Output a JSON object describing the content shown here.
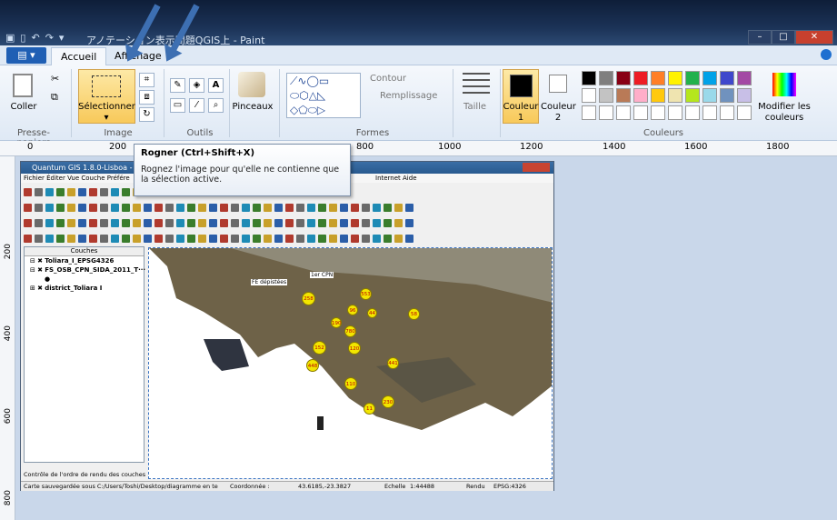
{
  "window": {
    "title": "アノテーション表示問題QGIS上 - Paint",
    "controls": [
      "–",
      "□",
      "✕"
    ]
  },
  "ribbon": {
    "file_menu": "▤ ▾",
    "tabs": [
      "Accueil",
      "Affichage"
    ],
    "coller": "Coller",
    "selectionner": "Sélectionner",
    "pinceaux": "Pinceaux",
    "contour": "Contour",
    "remplissage": "Remplissage",
    "taille": "Taille",
    "couleur1": "Couleur",
    "couleur1_num": "1",
    "couleur2": "Couleur",
    "couleur2_num": "2",
    "modifier": "Modifier les",
    "modifier2": "couleurs",
    "groups": {
      "presse": "Presse-papiers",
      "image": "Image",
      "outils": "Outils",
      "formes": "Formes",
      "couleurs": "Couleurs"
    },
    "palette": [
      "#000000",
      "#7f7f7f",
      "#880015",
      "#ed1c24",
      "#ff7f27",
      "#fff200",
      "#22b14c",
      "#00a2e8",
      "#3f48cc",
      "#a349a4",
      "#ffffff",
      "#c3c3c3",
      "#b97a57",
      "#ffaec9",
      "#ffc90e",
      "#efe4b0",
      "#b5e61d",
      "#99d9ea",
      "#7092be",
      "#c8bfe7"
    ]
  },
  "ruler": {
    "h": [
      "0",
      "200",
      "400",
      "800",
      "1000",
      "1200",
      "1400",
      "1600",
      "1800"
    ],
    "v": [
      "200",
      "400",
      "600",
      "800"
    ]
  },
  "tooltip": {
    "title": "Rogner (Ctrl+Shift+X)",
    "text": "Rognez l'image pour qu'elle ne contienne que la sélection active."
  },
  "qgis": {
    "title": "Quantum GIS 1.8.0-Lisboa - sess",
    "menu": "Fichier  Éditer  Vue  Couche  Préfére",
    "menu_right": "Internet  Aide",
    "layers_header": "Couches",
    "layers": [
      "Toliara_I_EPSG4326",
      "FS_OSB_CPN_SIDA_2011_T···",
      "district_Toliara I"
    ],
    "render_order": "Contrôle de l'ordre de rendu des couches",
    "status": "Carte sauvegardée sous C:/Users/Toshi/Desktop/diagramme en te",
    "coord_label": "Coordonnée :",
    "coord": "43.6185,-23.3827",
    "scale_label": "Echelle",
    "scale": "1:44488",
    "render": "Rendu",
    "epsg": "EPSG:4326",
    "map_labels": [
      "FE dépistées",
      "1er CPN"
    ],
    "points": [
      "258",
      "553",
      "96",
      "44",
      "58",
      "190",
      "780",
      "152",
      "120",
      "448",
      "441",
      "110",
      "230",
      "11"
    ]
  }
}
